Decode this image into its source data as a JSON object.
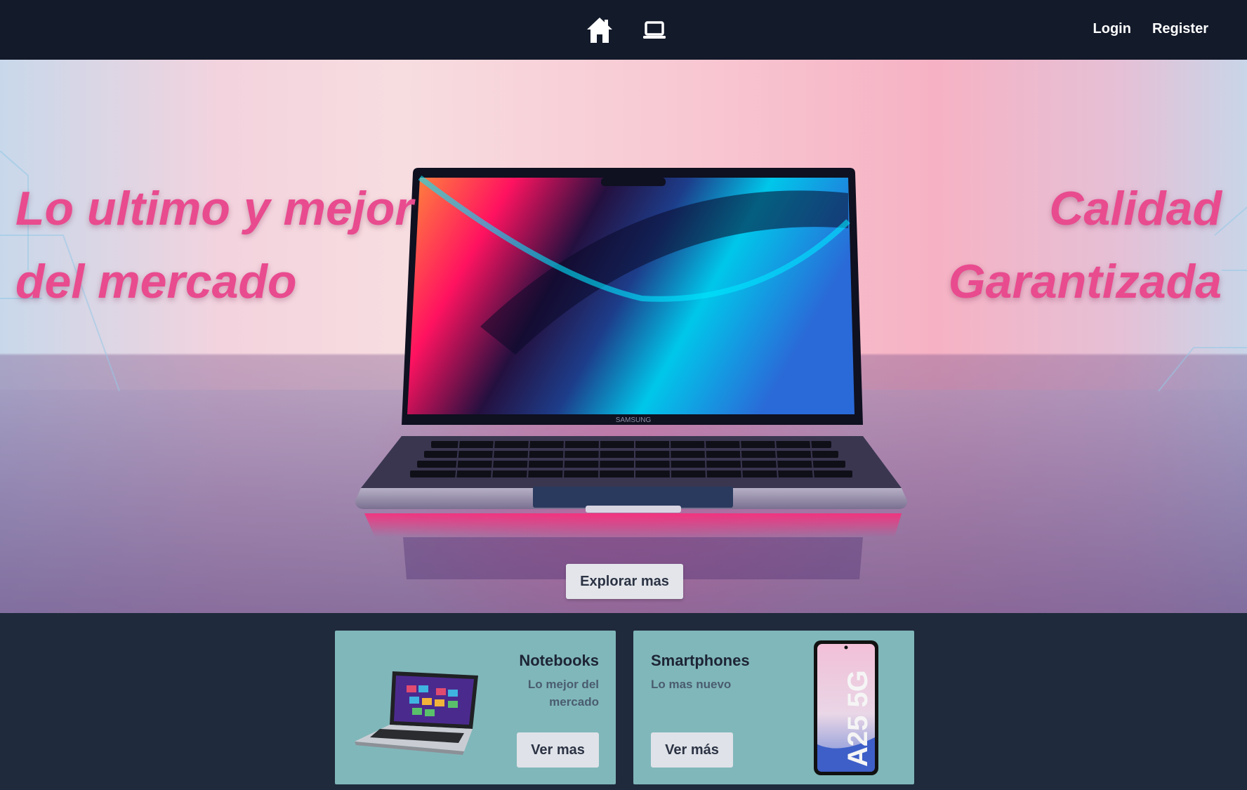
{
  "navbar": {
    "icons": [
      "home-icon",
      "laptop-icon"
    ],
    "login_label": "Login",
    "register_label": "Register"
  },
  "hero": {
    "left_line1": "Lo ultimo y mejor",
    "left_line2": "del mercado",
    "right_line1": "Calidad",
    "right_line2": "Garantizada",
    "laptop_brand": "SAMSUNG",
    "explore_label": "Explorar mas",
    "accent_color": "#e94b8f"
  },
  "cards": [
    {
      "title": "Notebooks",
      "subtitle": "Lo mejor del mercado",
      "button_label": "Ver mas"
    },
    {
      "title": "Smartphones",
      "subtitle": "Lo mas nuevo",
      "button_label": "Ver más",
      "phone_model": "A25 5G"
    }
  ],
  "colors": {
    "navbar_bg": "#131a2a",
    "page_bg": "#1f2a3c",
    "card_bg": "#80b7ba"
  }
}
